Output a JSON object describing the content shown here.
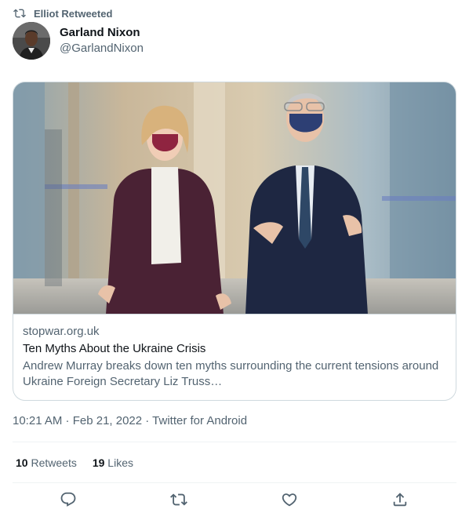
{
  "retweet_banner": {
    "label": "Elliot Retweeted",
    "icon": "retweet-icon"
  },
  "author": {
    "name": "Garland Nixon",
    "handle": "@GarlandNixon"
  },
  "card": {
    "domain": "stopwar.org.uk",
    "title": "Ten Myths About the Ukraine Crisis",
    "description": "Andrew Murray breaks down ten myths surrounding the current tensions around Ukraine Foreign Secretary Liz Truss…"
  },
  "meta": {
    "text": "10:21 AM · Feb 21, 2022 · Twitter for Android"
  },
  "stats": {
    "retweets_count": "10",
    "retweets_label": "Retweets",
    "likes_count": "19",
    "likes_label": "Likes"
  },
  "actions": [
    "reply-icon",
    "retweet-icon",
    "like-icon",
    "share-icon"
  ],
  "colors": {
    "text": "#0f1419",
    "secondary": "#536471",
    "border": "#cfd9de"
  }
}
